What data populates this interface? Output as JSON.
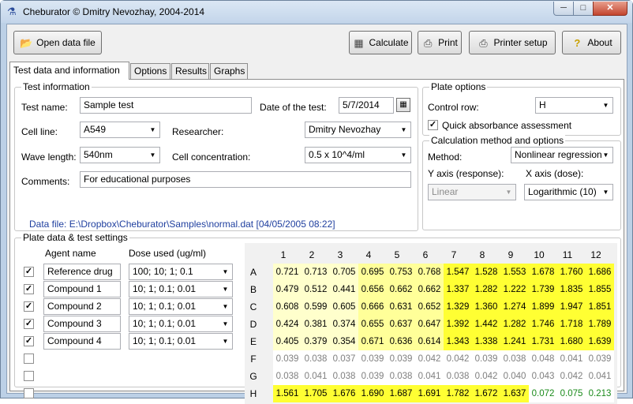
{
  "window": {
    "title": "Cheburator © Dmitry Nevozhay, 2004-2014"
  },
  "toolbar": {
    "open": "Open data file",
    "calculate": "Calculate",
    "print": "Print",
    "printer_setup": "Printer setup",
    "about": "About"
  },
  "tabs": [
    "Test data and information",
    "Options",
    "Results",
    "Graphs"
  ],
  "test_info": {
    "group_label": "Test information",
    "test_name_label": "Test name:",
    "test_name": "Sample test",
    "date_label": "Date of the test:",
    "date": "5/7/2014",
    "cell_line_label": "Cell line:",
    "cell_line": "A549",
    "researcher_label": "Researcher:",
    "researcher": "Dmitry Nevozhay",
    "wave_label": "Wave length:",
    "wave": "540nm",
    "conc_label": "Cell concentration:",
    "conc": "0.5 x 10^4/ml",
    "comments_label": "Comments:",
    "comments": "For educational purposes",
    "data_file": "Data file: E:\\Dropbox\\Cheburator\\Samples\\normal.dat",
    "data_file_time": "[04/05/2005 08:22]"
  },
  "plate_options": {
    "group_label": "Plate options",
    "control_row_label": "Control row:",
    "control_row": "H",
    "quick_label": "Quick absorbance assessment",
    "quick_checked": true
  },
  "calc_options": {
    "group_label": "Calculation method and options",
    "method_label": "Method:",
    "method": "Nonlinear regression",
    "y_label": "Y axis (response):",
    "x_label": "X axis (dose):",
    "y_axis": "Linear",
    "x_axis": "Logarithmic (10)"
  },
  "plate": {
    "group_label": "Plate data & test settings",
    "agent_header": "Agent name",
    "dose_header": "Dose used (ug/ml)",
    "agents": [
      {
        "checked": true,
        "name": "Reference drug",
        "dose": "100; 10; 1; 0.1"
      },
      {
        "checked": true,
        "name": "Compound 1",
        "dose": "10; 1; 0.1; 0.01"
      },
      {
        "checked": true,
        "name": "Compound 2",
        "dose": "10; 1; 0.1; 0.01"
      },
      {
        "checked": true,
        "name": "Compound 3",
        "dose": "10; 1; 0.1; 0.01"
      },
      {
        "checked": true,
        "name": "Compound 4",
        "dose": "10; 1; 0.1; 0.01"
      },
      {
        "checked": false,
        "name": "",
        "dose": ""
      },
      {
        "checked": false,
        "name": "",
        "dose": ""
      },
      {
        "checked": false,
        "name": "",
        "dose": ""
      }
    ],
    "columns": [
      "1",
      "2",
      "3",
      "4",
      "5",
      "6",
      "7",
      "8",
      "9",
      "10",
      "11",
      "12"
    ],
    "rows": [
      "A",
      "B",
      "C",
      "D",
      "E",
      "F",
      "G",
      "H"
    ],
    "values": [
      [
        "0.721",
        "0.713",
        "0.705",
        "0.695",
        "0.753",
        "0.768",
        "1.547",
        "1.528",
        "1.553",
        "1.678",
        "1.760",
        "1.686"
      ],
      [
        "0.479",
        "0.512",
        "0.441",
        "0.656",
        "0.662",
        "0.662",
        "1.337",
        "1.282",
        "1.222",
        "1.739",
        "1.835",
        "1.855"
      ],
      [
        "0.608",
        "0.599",
        "0.605",
        "0.666",
        "0.631",
        "0.652",
        "1.329",
        "1.360",
        "1.274",
        "1.899",
        "1.947",
        "1.851"
      ],
      [
        "0.424",
        "0.381",
        "0.374",
        "0.655",
        "0.637",
        "0.647",
        "1.392",
        "1.442",
        "1.282",
        "1.746",
        "1.718",
        "1.789"
      ],
      [
        "0.405",
        "0.379",
        "0.354",
        "0.671",
        "0.636",
        "0.614",
        "1.343",
        "1.338",
        "1.241",
        "1.731",
        "1.680",
        "1.639"
      ],
      [
        "0.039",
        "0.038",
        "0.037",
        "0.039",
        "0.039",
        "0.042",
        "0.042",
        "0.039",
        "0.038",
        "0.048",
        "0.041",
        "0.039"
      ],
      [
        "0.038",
        "0.041",
        "0.038",
        "0.039",
        "0.038",
        "0.041",
        "0.038",
        "0.042",
        "0.040",
        "0.043",
        "0.042",
        "0.041"
      ],
      [
        "1.561",
        "1.705",
        "1.676",
        "1.690",
        "1.687",
        "1.691",
        "1.782",
        "1.672",
        "1.637",
        "0.072",
        "0.075",
        "0.213"
      ]
    ],
    "colors": {
      "bright": "#ffff33",
      "mid": "#ffff99",
      "pale": "#ffffcc",
      "blank_text": "#7f7f7f",
      "control_text": "#1a8a1a"
    }
  }
}
